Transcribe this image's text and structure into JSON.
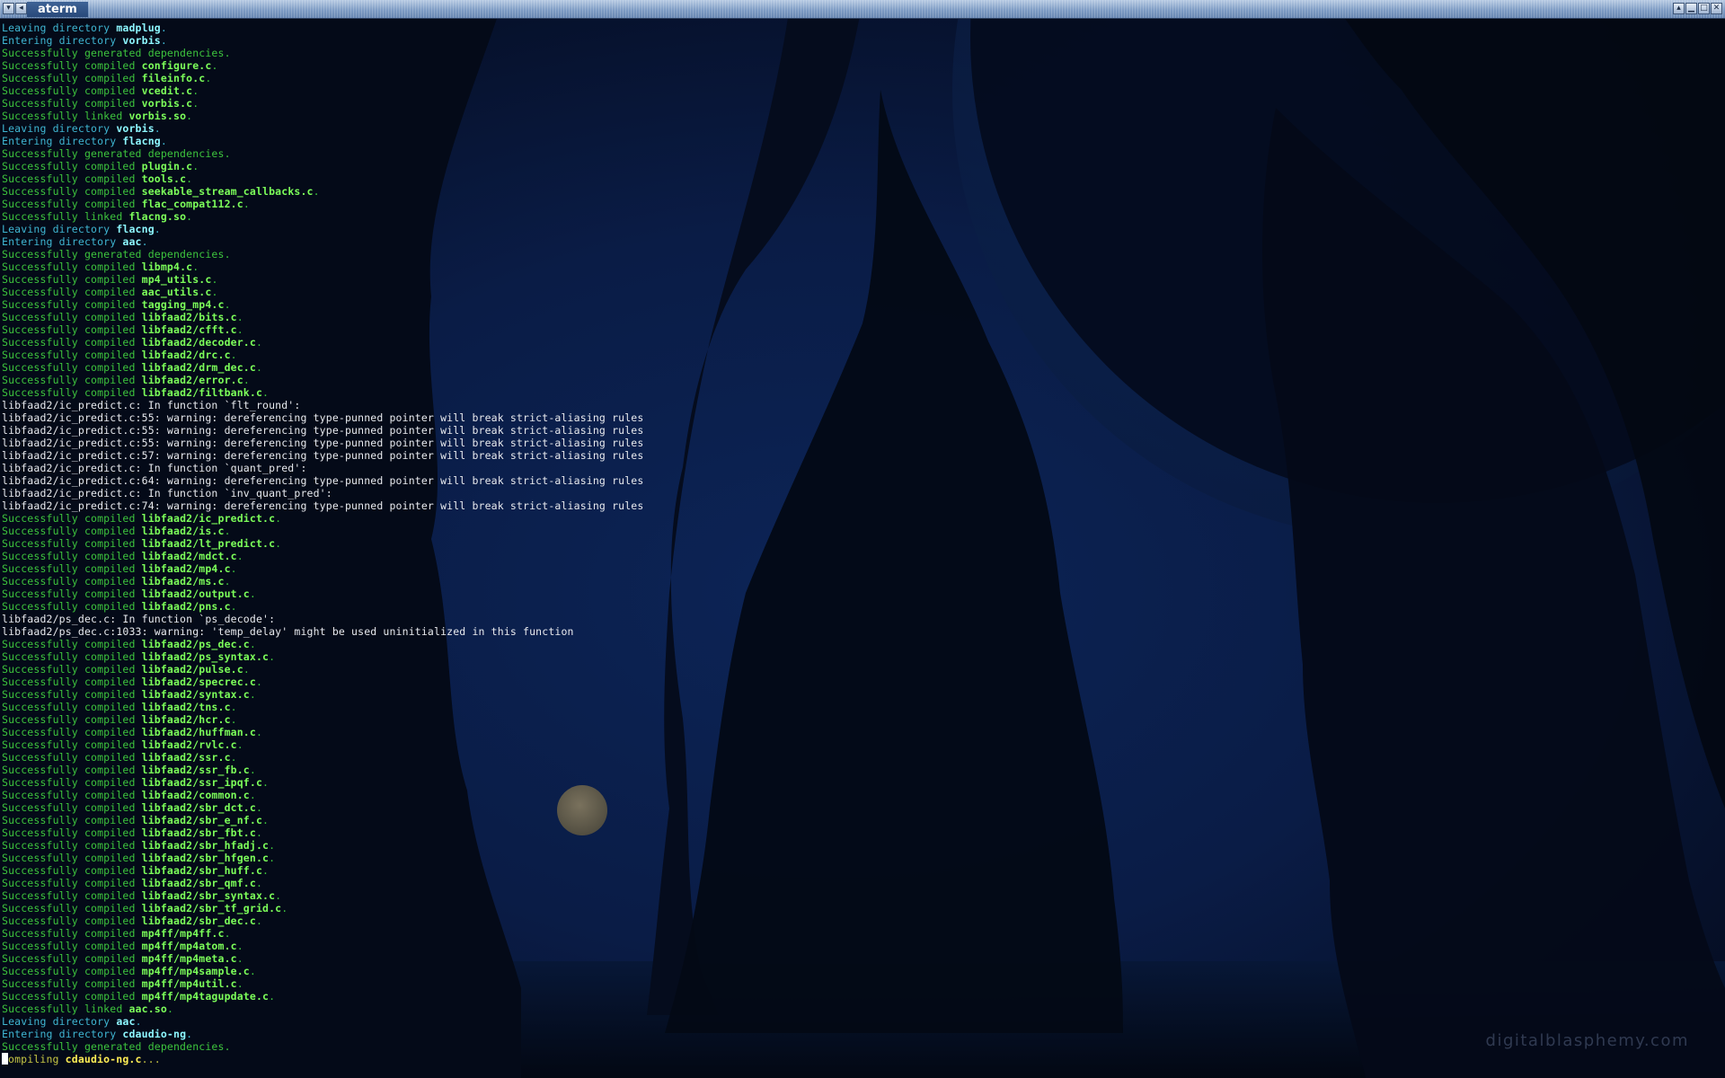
{
  "window": {
    "title": "aterm",
    "left_buttons": [
      "▾",
      "◂"
    ],
    "right_buttons": [
      "▴",
      "▁",
      "□",
      "✕"
    ]
  },
  "terminal": {
    "lines": [
      {
        "type": "leave",
        "prefix": "Leaving directory ",
        "target": "madplug",
        "suffix": "."
      },
      {
        "type": "enter",
        "prefix": "Entering directory ",
        "target": "vorbis",
        "suffix": "."
      },
      {
        "type": "gen",
        "prefix": "Successfully generated dependencies."
      },
      {
        "type": "compiled",
        "prefix": "Successfully compiled ",
        "target": "configure.c",
        "suffix": "."
      },
      {
        "type": "compiled",
        "prefix": "Successfully compiled ",
        "target": "fileinfo.c",
        "suffix": "."
      },
      {
        "type": "compiled",
        "prefix": "Successfully compiled ",
        "target": "vcedit.c",
        "suffix": "."
      },
      {
        "type": "compiled",
        "prefix": "Successfully compiled ",
        "target": "vorbis.c",
        "suffix": "."
      },
      {
        "type": "linked",
        "prefix": "Successfully linked ",
        "target": "vorbis.so",
        "suffix": "."
      },
      {
        "type": "leave",
        "prefix": "Leaving directory ",
        "target": "vorbis",
        "suffix": "."
      },
      {
        "type": "enter",
        "prefix": "Entering directory ",
        "target": "flacng",
        "suffix": "."
      },
      {
        "type": "gen",
        "prefix": "Successfully generated dependencies."
      },
      {
        "type": "compiled",
        "prefix": "Successfully compiled ",
        "target": "plugin.c",
        "suffix": "."
      },
      {
        "type": "compiled",
        "prefix": "Successfully compiled ",
        "target": "tools.c",
        "suffix": "."
      },
      {
        "type": "compiled",
        "prefix": "Successfully compiled ",
        "target": "seekable_stream_callbacks.c",
        "suffix": "."
      },
      {
        "type": "compiled",
        "prefix": "Successfully compiled ",
        "target": "flac_compat112.c",
        "suffix": "."
      },
      {
        "type": "linked",
        "prefix": "Successfully linked ",
        "target": "flacng.so",
        "suffix": "."
      },
      {
        "type": "leave",
        "prefix": "Leaving directory ",
        "target": "flacng",
        "suffix": "."
      },
      {
        "type": "enter",
        "prefix": "Entering directory ",
        "target": "aac",
        "suffix": "."
      },
      {
        "type": "gen",
        "prefix": "Successfully generated dependencies."
      },
      {
        "type": "compiled",
        "prefix": "Successfully compiled ",
        "target": "libmp4.c",
        "suffix": "."
      },
      {
        "type": "compiled",
        "prefix": "Successfully compiled ",
        "target": "mp4_utils.c",
        "suffix": "."
      },
      {
        "type": "compiled",
        "prefix": "Successfully compiled ",
        "target": "aac_utils.c",
        "suffix": "."
      },
      {
        "type": "compiled",
        "prefix": "Successfully compiled ",
        "target": "tagging_mp4.c",
        "suffix": "."
      },
      {
        "type": "compiled",
        "prefix": "Successfully compiled ",
        "target": "libfaad2/bits.c",
        "suffix": "."
      },
      {
        "type": "compiled",
        "prefix": "Successfully compiled ",
        "target": "libfaad2/cfft.c",
        "suffix": "."
      },
      {
        "type": "compiled",
        "prefix": "Successfully compiled ",
        "target": "libfaad2/decoder.c",
        "suffix": "."
      },
      {
        "type": "compiled",
        "prefix": "Successfully compiled ",
        "target": "libfaad2/drc.c",
        "suffix": "."
      },
      {
        "type": "compiled",
        "prefix": "Successfully compiled ",
        "target": "libfaad2/drm_dec.c",
        "suffix": "."
      },
      {
        "type": "compiled",
        "prefix": "Successfully compiled ",
        "target": "libfaad2/error.c",
        "suffix": "."
      },
      {
        "type": "compiled",
        "prefix": "Successfully compiled ",
        "target": "libfaad2/filtbank.c",
        "suffix": "."
      },
      {
        "type": "warn",
        "prefix": "libfaad2/ic_predict.c: In function `flt_round':"
      },
      {
        "type": "warn",
        "prefix": "libfaad2/ic_predict.c:55: warning: dereferencing type-punned pointer will break strict-aliasing rules"
      },
      {
        "type": "warn",
        "prefix": "libfaad2/ic_predict.c:55: warning: dereferencing type-punned pointer will break strict-aliasing rules"
      },
      {
        "type": "warn",
        "prefix": "libfaad2/ic_predict.c:55: warning: dereferencing type-punned pointer will break strict-aliasing rules"
      },
      {
        "type": "warn",
        "prefix": "libfaad2/ic_predict.c:57: warning: dereferencing type-punned pointer will break strict-aliasing rules"
      },
      {
        "type": "warn",
        "prefix": "libfaad2/ic_predict.c: In function `quant_pred':"
      },
      {
        "type": "warn",
        "prefix": "libfaad2/ic_predict.c:64: warning: dereferencing type-punned pointer will break strict-aliasing rules"
      },
      {
        "type": "warn",
        "prefix": "libfaad2/ic_predict.c: In function `inv_quant_pred':"
      },
      {
        "type": "warn",
        "prefix": "libfaad2/ic_predict.c:74: warning: dereferencing type-punned pointer will break strict-aliasing rules"
      },
      {
        "type": "compiled",
        "prefix": "Successfully compiled ",
        "target": "libfaad2/ic_predict.c",
        "suffix": "."
      },
      {
        "type": "compiled",
        "prefix": "Successfully compiled ",
        "target": "libfaad2/is.c",
        "suffix": "."
      },
      {
        "type": "compiled",
        "prefix": "Successfully compiled ",
        "target": "libfaad2/lt_predict.c",
        "suffix": "."
      },
      {
        "type": "compiled",
        "prefix": "Successfully compiled ",
        "target": "libfaad2/mdct.c",
        "suffix": "."
      },
      {
        "type": "compiled",
        "prefix": "Successfully compiled ",
        "target": "libfaad2/mp4.c",
        "suffix": "."
      },
      {
        "type": "compiled",
        "prefix": "Successfully compiled ",
        "target": "libfaad2/ms.c",
        "suffix": "."
      },
      {
        "type": "compiled",
        "prefix": "Successfully compiled ",
        "target": "libfaad2/output.c",
        "suffix": "."
      },
      {
        "type": "compiled",
        "prefix": "Successfully compiled ",
        "target": "libfaad2/pns.c",
        "suffix": "."
      },
      {
        "type": "warn",
        "prefix": "libfaad2/ps_dec.c: In function `ps_decode':"
      },
      {
        "type": "warn",
        "prefix": "libfaad2/ps_dec.c:1033: warning: 'temp_delay' might be used uninitialized in this function"
      },
      {
        "type": "compiled",
        "prefix": "Successfully compiled ",
        "target": "libfaad2/ps_dec.c",
        "suffix": "."
      },
      {
        "type": "compiled",
        "prefix": "Successfully compiled ",
        "target": "libfaad2/ps_syntax.c",
        "suffix": "."
      },
      {
        "type": "compiled",
        "prefix": "Successfully compiled ",
        "target": "libfaad2/pulse.c",
        "suffix": "."
      },
      {
        "type": "compiled",
        "prefix": "Successfully compiled ",
        "target": "libfaad2/specrec.c",
        "suffix": "."
      },
      {
        "type": "compiled",
        "prefix": "Successfully compiled ",
        "target": "libfaad2/syntax.c",
        "suffix": "."
      },
      {
        "type": "compiled",
        "prefix": "Successfully compiled ",
        "target": "libfaad2/tns.c",
        "suffix": "."
      },
      {
        "type": "compiled",
        "prefix": "Successfully compiled ",
        "target": "libfaad2/hcr.c",
        "suffix": "."
      },
      {
        "type": "compiled",
        "prefix": "Successfully compiled ",
        "target": "libfaad2/huffman.c",
        "suffix": "."
      },
      {
        "type": "compiled",
        "prefix": "Successfully compiled ",
        "target": "libfaad2/rvlc.c",
        "suffix": "."
      },
      {
        "type": "compiled",
        "prefix": "Successfully compiled ",
        "target": "libfaad2/ssr.c",
        "suffix": "."
      },
      {
        "type": "compiled",
        "prefix": "Successfully compiled ",
        "target": "libfaad2/ssr_fb.c",
        "suffix": "."
      },
      {
        "type": "compiled",
        "prefix": "Successfully compiled ",
        "target": "libfaad2/ssr_ipqf.c",
        "suffix": "."
      },
      {
        "type": "compiled",
        "prefix": "Successfully compiled ",
        "target": "libfaad2/common.c",
        "suffix": "."
      },
      {
        "type": "compiled",
        "prefix": "Successfully compiled ",
        "target": "libfaad2/sbr_dct.c",
        "suffix": "."
      },
      {
        "type": "compiled",
        "prefix": "Successfully compiled ",
        "target": "libfaad2/sbr_e_nf.c",
        "suffix": "."
      },
      {
        "type": "compiled",
        "prefix": "Successfully compiled ",
        "target": "libfaad2/sbr_fbt.c",
        "suffix": "."
      },
      {
        "type": "compiled",
        "prefix": "Successfully compiled ",
        "target": "libfaad2/sbr_hfadj.c",
        "suffix": "."
      },
      {
        "type": "compiled",
        "prefix": "Successfully compiled ",
        "target": "libfaad2/sbr_hfgen.c",
        "suffix": "."
      },
      {
        "type": "compiled",
        "prefix": "Successfully compiled ",
        "target": "libfaad2/sbr_huff.c",
        "suffix": "."
      },
      {
        "type": "compiled",
        "prefix": "Successfully compiled ",
        "target": "libfaad2/sbr_qmf.c",
        "suffix": "."
      },
      {
        "type": "compiled",
        "prefix": "Successfully compiled ",
        "target": "libfaad2/sbr_syntax.c",
        "suffix": "."
      },
      {
        "type": "compiled",
        "prefix": "Successfully compiled ",
        "target": "libfaad2/sbr_tf_grid.c",
        "suffix": "."
      },
      {
        "type": "compiled",
        "prefix": "Successfully compiled ",
        "target": "libfaad2/sbr_dec.c",
        "suffix": "."
      },
      {
        "type": "compiled",
        "prefix": "Successfully compiled ",
        "target": "mp4ff/mp4ff.c",
        "suffix": "."
      },
      {
        "type": "compiled",
        "prefix": "Successfully compiled ",
        "target": "mp4ff/mp4atom.c",
        "suffix": "."
      },
      {
        "type": "compiled",
        "prefix": "Successfully compiled ",
        "target": "mp4ff/mp4meta.c",
        "suffix": "."
      },
      {
        "type": "compiled",
        "prefix": "Successfully compiled ",
        "target": "mp4ff/mp4sample.c",
        "suffix": "."
      },
      {
        "type": "compiled",
        "prefix": "Successfully compiled ",
        "target": "mp4ff/mp4util.c",
        "suffix": "."
      },
      {
        "type": "compiled",
        "prefix": "Successfully compiled ",
        "target": "mp4ff/mp4tagupdate.c",
        "suffix": "."
      },
      {
        "type": "linked",
        "prefix": "Successfully linked ",
        "target": "aac.so",
        "suffix": "."
      },
      {
        "type": "leave",
        "prefix": "Leaving directory ",
        "target": "aac",
        "suffix": "."
      },
      {
        "type": "enter",
        "prefix": "Entering directory ",
        "target": "cdaudio-ng",
        "suffix": "."
      },
      {
        "type": "gen",
        "prefix": "Successfully generated dependencies."
      },
      {
        "type": "compiling",
        "prefix": "ompiling ",
        "target": "cdaudio-ng.c",
        "suffix": "...",
        "cursor": true
      }
    ]
  },
  "wallpaper": {
    "watermark": "digitalblasphemy.com"
  },
  "colors": {
    "success_text": "#3dc43d",
    "directory_text": "#3fb6d2",
    "file_highlight": "#7cff5a",
    "dir_highlight": "#8df7ff",
    "compiling_highlight": "#ffee55",
    "warning_text": "#e8eaee",
    "titlebar": "#7e9cc4"
  }
}
